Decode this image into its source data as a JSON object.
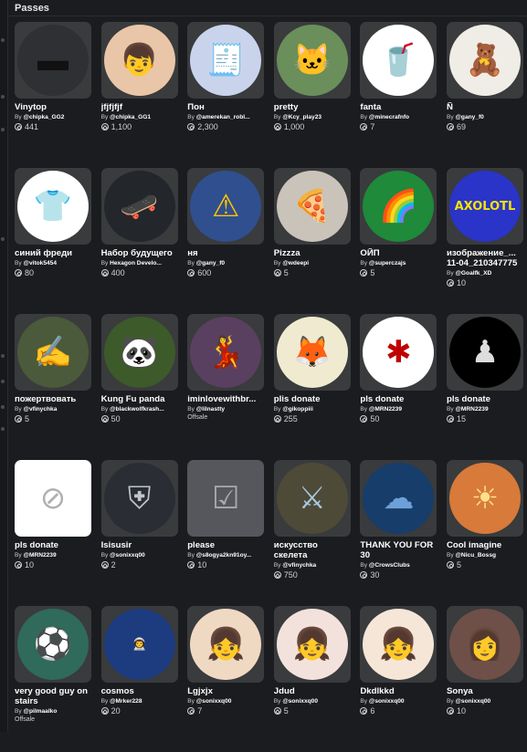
{
  "header": {
    "title": "Passes"
  },
  "items": [
    {
      "name": "Vinytop",
      "creator": "@chipka_GG2",
      "price": "441",
      "bg": "#2f3033",
      "glyph": "▬",
      "fg": "#111"
    },
    {
      "name": "jfjfjfjf",
      "creator": "@chipka_GG1",
      "price": "1,100",
      "bg": "#e9c6a7",
      "glyph": "👦",
      "fg": "#000"
    },
    {
      "name": "Пон",
      "creator": "@amerekan_robl...",
      "price": "2,300",
      "bg": "#c9d4ec",
      "glyph": "🧾",
      "fg": "#000"
    },
    {
      "name": "pretty",
      "creator": "@Kcy_play23",
      "price": "1,000",
      "bg": "#6a8f5a",
      "glyph": "🐱",
      "fg": "#000"
    },
    {
      "name": "fanta",
      "creator": "@minecrafnfo",
      "price": "7",
      "bg": "#ffffff",
      "glyph": "🥤",
      "fg": "#e56a00"
    },
    {
      "name": "Ñ",
      "creator": "@gany_f0",
      "price": "69",
      "bg": "#f0ede6",
      "glyph": "🧸",
      "fg": "#000"
    },
    {
      "name": "синий фреди",
      "creator": "@vitok5454",
      "price": "80",
      "bg": "#ffffff",
      "glyph": "👕",
      "fg": "#1e5ac8"
    },
    {
      "name": "Набор будущего",
      "creator": "Hexagon Develo...",
      "price": "400",
      "bg": "#23262b",
      "glyph": "🛹",
      "fg": "#7fb0d0"
    },
    {
      "name": "ня",
      "creator": "@gany_f0",
      "price": "600",
      "bg": "#2f4f8f",
      "glyph": "⚠",
      "fg": "#ffc400"
    },
    {
      "name": "Pizzza",
      "creator": "@wdeepi",
      "price": "5",
      "bg": "#c9c3ba",
      "glyph": "🍕",
      "fg": "#000"
    },
    {
      "name": "ОЙП",
      "creator": "@superczajs",
      "price": "5",
      "bg": "#1e8a3a",
      "glyph": "🌈",
      "fg": "#000"
    },
    {
      "name": "изображение_... 11-04_210347775",
      "creator": "@Goalfk_XD",
      "price": "10",
      "bg": "#2a34c8",
      "glyph": "AXOLOTL",
      "fg": "#f5e400"
    },
    {
      "name": "пожертвовать",
      "creator": "@vfinychka",
      "price": "5",
      "bg": "#4a5a3a",
      "glyph": "✍",
      "fg": "#e8e0c0"
    },
    {
      "name": "Kung Fu panda",
      "creator": "@blackwolfkrash...",
      "price": "50",
      "bg": "#3d5a2a",
      "glyph": "🐼",
      "fg": "#000"
    },
    {
      "name": "iminlovewithbr...",
      "creator": "@lilnastty",
      "price": "",
      "offsale": "Offsale",
      "bg": "#5a4060",
      "glyph": "💃",
      "fg": "#000"
    },
    {
      "name": "plis donate",
      "creator": "@gikoppiii",
      "price": "255",
      "bg": "#f0ead0",
      "glyph": "🦊",
      "fg": "#000"
    },
    {
      "name": "pls donate",
      "creator": "@MRN2239",
      "price": "50",
      "bg": "#ffffff",
      "glyph": "✱",
      "fg": "#c00000"
    },
    {
      "name": "pls donate",
      "creator": "@MRN2239",
      "price": "15",
      "bg": "#000000",
      "glyph": "♟",
      "fg": "#ddd"
    },
    {
      "name": "pls donate",
      "creator": "@MRN2239",
      "price": "10",
      "bg": "#ffffff",
      "glyph": "⊘",
      "fg": "#b0b0b0",
      "square": true
    },
    {
      "name": "Isisusir",
      "creator": "@sonixxq00",
      "price": "2",
      "bg": "#2a2d33",
      "glyph": "⛨",
      "fg": "#c0c4cc"
    },
    {
      "name": "please",
      "creator": "@s8ogya2kn91oy...",
      "price": "10",
      "bg": "#55575c",
      "glyph": "☑",
      "fg": "#aaa",
      "square": true
    },
    {
      "name": "искусство скелета",
      "creator": "@vfinychka",
      "price": "750",
      "bg": "#4d4a38",
      "glyph": "⚔",
      "fg": "#a8c8e0"
    },
    {
      "name": "THANK YOU FOR 30",
      "creator": "@CrowsClubs",
      "price": "30",
      "bg": "#173d6a",
      "glyph": "☁",
      "fg": "#6ea0d8"
    },
    {
      "name": "Cool imagine",
      "creator": "@Nicu_Bossg",
      "price": "5",
      "bg": "#d77a3a",
      "glyph": "☀",
      "fg": "#ffe08a"
    },
    {
      "name": "very good guy on stairs",
      "creator": "@pilmaalko",
      "price": "",
      "offsale": "Offsale",
      "bg": "#2f6a5a",
      "glyph": "⚽",
      "fg": "#fff"
    },
    {
      "name": "cosmos",
      "creator": "@Mrker228",
      "price": "20",
      "bg": "#1d3c80",
      "glyph": "👨‍🚀",
      "fg": "#fff"
    },
    {
      "name": "Lgjxjx",
      "creator": "@sonixxq00",
      "price": "7",
      "bg": "#f0d9c3",
      "glyph": "👧",
      "fg": "#000"
    },
    {
      "name": "Jdud",
      "creator": "@sonixxq00",
      "price": "5",
      "bg": "#f3e2dc",
      "glyph": "👧",
      "fg": "#000"
    },
    {
      "name": "Dkdlkkd",
      "creator": "@sonixxq00",
      "price": "6",
      "bg": "#f5e6d8",
      "glyph": "👧",
      "fg": "#000"
    },
    {
      "name": "Sonya",
      "creator": "@sonixxq00",
      "price": "10",
      "bg": "#6e5048",
      "glyph": "👩",
      "fg": "#000"
    }
  ],
  "labels": {
    "by": "By "
  }
}
